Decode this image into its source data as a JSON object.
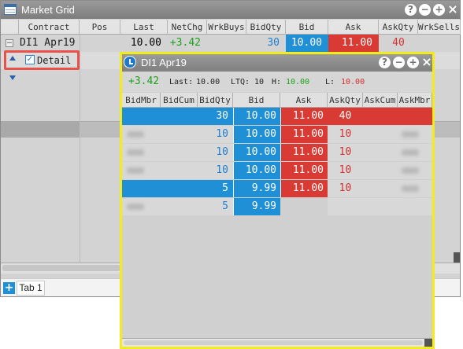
{
  "market_grid": {
    "title": "Market Grid",
    "columns": [
      "Contract",
      "Pos",
      "Last",
      "NetChg",
      "WrkBuys",
      "BidQty",
      "Bid",
      "Ask",
      "AskQty",
      "WrkSells"
    ],
    "row": {
      "contract": "DI1 Apr19",
      "pos": "",
      "last": "10.00",
      "netchg": "+3.42",
      "wrkbuys": "",
      "bidqty": "30",
      "bid": "10.00",
      "ask": "11.00",
      "askqty": "40",
      "wrksells": ""
    },
    "detail_label": "Detail",
    "detail_checked": true,
    "tab": "Tab 1",
    "add_tab": "+"
  },
  "window_buttons": {
    "help": "?",
    "minimize": "−",
    "maximize": "+",
    "close": "×"
  },
  "detail_window": {
    "title": "DI1 Apr19",
    "netchg": "+3.42",
    "last_label": "Last:",
    "last_value": "10.00",
    "ltq_label": "LTQ:",
    "ltq_value": "10",
    "high_label": "H:",
    "high_value": "10.00",
    "low_label": "L:",
    "low_value": "10.00",
    "columns": [
      "BidMbr",
      "BidCum",
      "BidQty",
      "Bid",
      "Ask",
      "AskQty",
      "AskCum",
      "AskMbr"
    ],
    "rows": [
      {
        "bidqty": "30",
        "bid": "10.00",
        "ask": "11.00",
        "askqty": "40",
        "highlight": true
      },
      {
        "bidqty": "10",
        "bid": "10.00",
        "ask": "11.00",
        "askqty": "10",
        "highlight": false
      },
      {
        "bidqty": "10",
        "bid": "10.00",
        "ask": "11.00",
        "askqty": "10",
        "highlight": false
      },
      {
        "bidqty": "10",
        "bid": "10.00",
        "ask": "11.00",
        "askqty": "10",
        "highlight": false
      },
      {
        "bidqty": "5",
        "bid": "9.99",
        "ask": "11.00",
        "askqty": "10",
        "highlight": true
      },
      {
        "bidqty": "5",
        "bid": "9.99",
        "ask": "",
        "askqty": "",
        "highlight": false
      }
    ]
  },
  "colors": {
    "bid": "#1f8fd6",
    "ask": "#d93a33",
    "highlight_border": "#f2ec1d",
    "callout": "#e8524a"
  }
}
